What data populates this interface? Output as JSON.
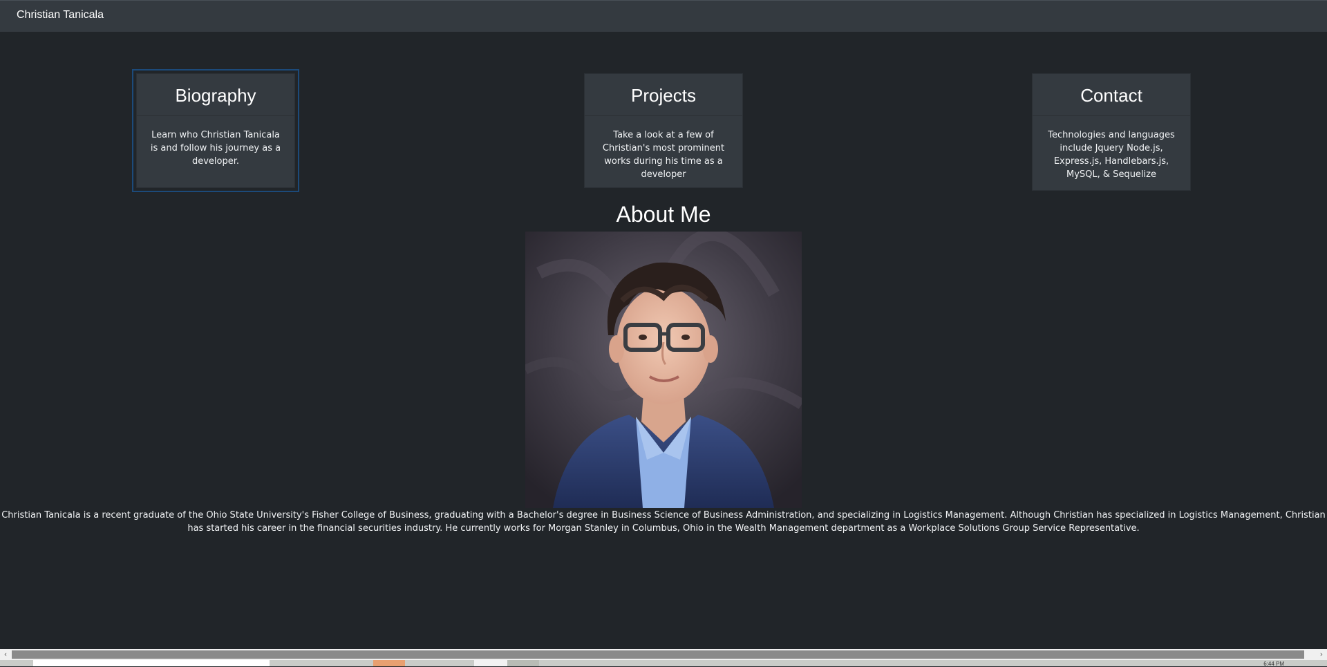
{
  "navbar": {
    "brand": "Christian Tanicala"
  },
  "cards": [
    {
      "title": "Biography",
      "body": "Learn who Christian Tanicala is and follow his journey as a developer."
    },
    {
      "title": "Projects",
      "body": "Take a look at a few of Christian's most prominent works during his time as a developer"
    },
    {
      "title": "Contact",
      "body": "Technologies and languages include Jquery Node.js, Express.js, Handlebars.js, MySQL, & Sequelize"
    }
  ],
  "about": {
    "heading": "About Me",
    "text": "Christian Tanicala is a recent graduate of the Ohio State University's Fisher College of Business, graduating with a Bachelor's degree in Business Science of Business Administration, and specializing in Logistics Management. Although Christian has specialized in Logistics Management, Christian has started his career in the financial securities industry. He currently works for Morgan Stanley in Columbus, Ohio in the Wealth Management department as a Workplace Solutions Group Service Representative."
  },
  "scrollbar": {
    "left_icon": "chevron-left-icon",
    "right_icon": "chevron-right-icon"
  },
  "taskbar": {
    "clock": "6:44 PM"
  },
  "colors": {
    "background": "#212529",
    "navbar": "#343a40",
    "card": "#343a40",
    "focus_ring": "#1c4a7a"
  }
}
